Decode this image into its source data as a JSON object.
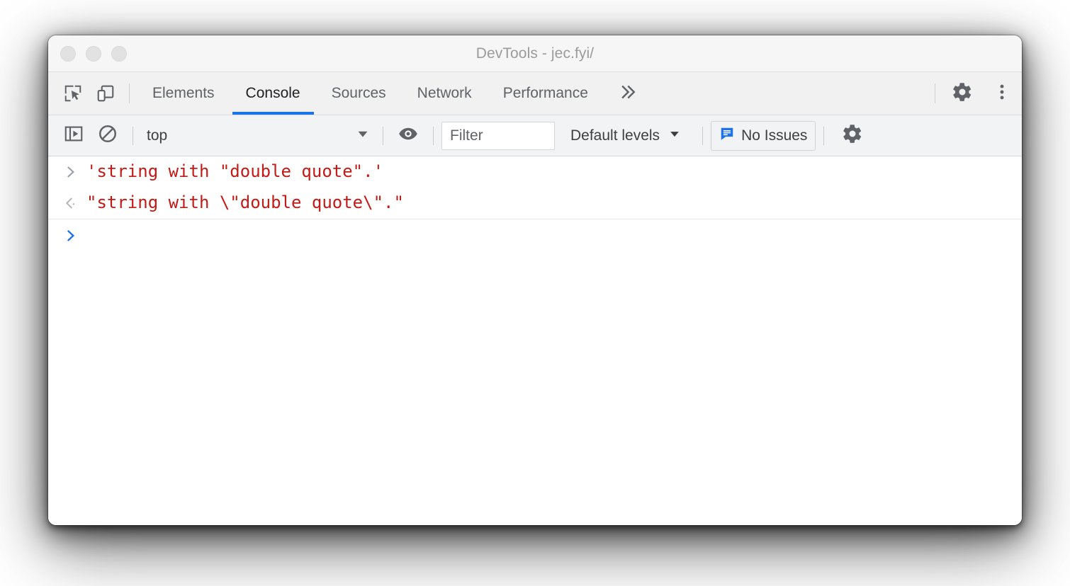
{
  "window": {
    "title": "DevTools - jec.fyi/",
    "traffic_lights": [
      "close",
      "minimize",
      "maximize"
    ]
  },
  "colors": {
    "accent_blue": "#1a73e8",
    "string_red": "#c41a16",
    "titlebar_bg": "#f6f6f6",
    "tabbar_bg": "#f1f1f1",
    "toolbar_bg": "#f1f3f4",
    "body_bg": "#ffffff",
    "icon_gray": "#5f6368",
    "title_gray": "#9b9b9b"
  },
  "tabbar": {
    "inspect_icon": "inspect-element-icon",
    "device_icon": "device-toolbar-icon",
    "tabs": [
      {
        "label": "Elements",
        "active": false
      },
      {
        "label": "Console",
        "active": true
      },
      {
        "label": "Sources",
        "active": false
      },
      {
        "label": "Network",
        "active": false
      },
      {
        "label": "Performance",
        "active": false
      }
    ],
    "more_tabs_icon": "chevron-double-right-icon",
    "settings_icon": "gear-icon",
    "menu_icon": "kebab-menu-icon"
  },
  "console_toolbar": {
    "sidebar_toggle_icon": "console-sidebar-icon",
    "clear_console_icon": "clear-console-icon",
    "context": {
      "value": "top",
      "arrow_icon": "triangle-down-icon"
    },
    "live_expression_icon": "eye-icon",
    "filter": {
      "value": "",
      "placeholder": "Filter"
    },
    "levels": {
      "label": "Default levels",
      "arrow_icon": "triangle-down-icon"
    },
    "issues": {
      "label": "No Issues",
      "icon": "issues-bubble-icon"
    },
    "settings_icon": "gear-icon"
  },
  "console_messages": [
    {
      "kind": "input",
      "gutter_icon": "input-chevron-right-icon",
      "text": "'string with \"double quote\".'"
    },
    {
      "kind": "result",
      "gutter_icon": "result-chevron-left-icon",
      "text": "\"string with \\\"double quote\\\".\""
    }
  ],
  "console_prompt": {
    "gutter_icon": "prompt-chevron-right-icon",
    "value": ""
  }
}
